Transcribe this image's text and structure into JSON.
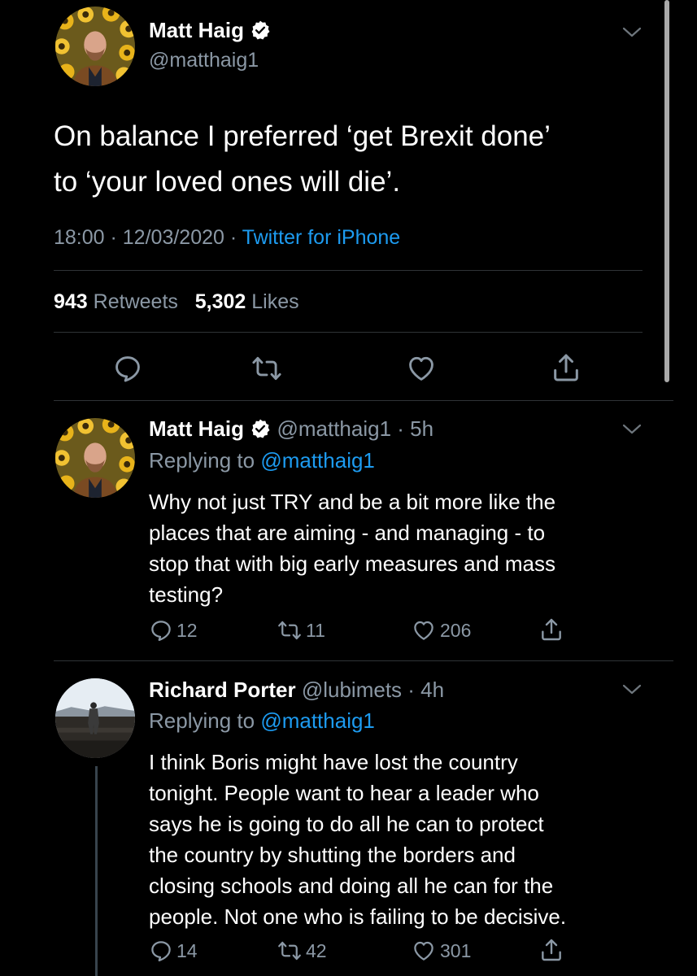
{
  "main_tweet": {
    "author_name": "Matt Haig",
    "author_handle": "@matthaig1",
    "text_line1": "On balance I preferred ‘get Brexit done’",
    "text_line2": "to ‘your loved ones will die’.",
    "time": "18:00",
    "date": "12/03/2020",
    "source": "Twitter for iPhone",
    "retweets_count": "943",
    "retweets_label": "Retweets",
    "likes_count": "5,302",
    "likes_label": "Likes"
  },
  "replies": [
    {
      "author_name": "Matt Haig",
      "author_handle": "@matthaig1",
      "time_ago": "5h",
      "replying_label": "Replying to",
      "replying_to": "@matthaig1",
      "lines": [
        "Why not just TRY and be a bit more like the",
        "places that are aiming - and managing - to",
        "stop that with big early measures and mass",
        "testing?"
      ],
      "replies_count": "12",
      "retweets_count": "11",
      "likes_count": "206"
    },
    {
      "author_name": "Richard Porter",
      "author_handle": "@lubimets",
      "time_ago": "4h",
      "replying_label": "Replying to",
      "replying_to": "@matthaig1",
      "lines": [
        "I think Boris might have lost the country",
        "tonight. People want to hear a leader who",
        "says he is going to do all he can to protect",
        "the country by shutting the borders and",
        "closing schools and doing all he can for the",
        "people. Not one who is failing to be decisive."
      ],
      "replies_count": "14",
      "retweets_count": "42",
      "likes_count": "301"
    }
  ],
  "icons": {
    "reply": "speech-bubble",
    "retweet": "retweet-arrows",
    "like": "heart",
    "share": "share-arrow",
    "more": "chevron-down",
    "verified": "verified-badge"
  },
  "colors": {
    "background": "#000000",
    "text": "#e7e9ea",
    "muted": "#8b98a5",
    "link": "#1d9bf0",
    "divider": "#2f3336"
  }
}
